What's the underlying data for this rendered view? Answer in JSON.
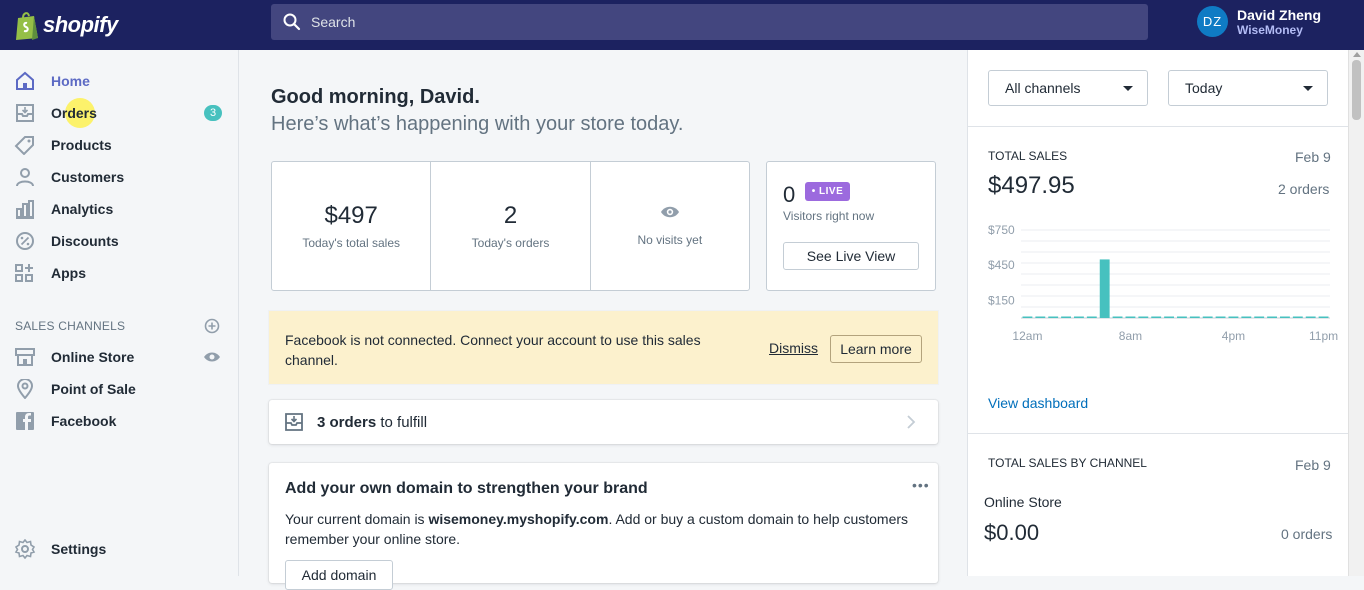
{
  "brand": {
    "logo_text": "shopify"
  },
  "search": {
    "placeholder": "Search"
  },
  "user": {
    "initials": "DZ",
    "name": "David Zheng",
    "store": "WiseMoney"
  },
  "sidebar": {
    "items": [
      {
        "label": "Home",
        "icon": "home-icon"
      },
      {
        "label": "Orders",
        "icon": "orders-icon",
        "badge": "3"
      },
      {
        "label": "Products",
        "icon": "tag-icon"
      },
      {
        "label": "Customers",
        "icon": "person-icon"
      },
      {
        "label": "Analytics",
        "icon": "bar-chart-icon"
      },
      {
        "label": "Discounts",
        "icon": "discount-icon"
      },
      {
        "label": "Apps",
        "icon": "apps-icon"
      }
    ],
    "channels_heading": "SALES CHANNELS",
    "channels": [
      {
        "label": "Online Store",
        "icon": "store-icon"
      },
      {
        "label": "Point of Sale",
        "icon": "location-pin-icon"
      },
      {
        "label": "Facebook",
        "icon": "facebook-icon"
      }
    ],
    "settings_label": "Settings"
  },
  "greeting": {
    "title": "Good morning, David.",
    "subtitle": "Here’s what’s happening with your store today."
  },
  "stats": [
    {
      "value": "$497",
      "label": "Today's total sales"
    },
    {
      "value": "2",
      "label": "Today's orders"
    },
    {
      "value": "",
      "label": "No visits yet"
    }
  ],
  "live": {
    "count": "0",
    "badge": "• LIVE",
    "subtitle": "Visitors right now",
    "button": "See Live View"
  },
  "banner": {
    "text": "Facebook is not connected. Connect your account to use this sales channel.",
    "dismiss": "Dismiss",
    "learn_more": "Learn more"
  },
  "fulfill": {
    "count_text": "3 orders",
    "suffix": " to fulfill"
  },
  "domain": {
    "title": "Add your own domain to strengthen your brand",
    "text_prefix": "Your current domain is ",
    "domain_name": "wisemoney.myshopify.com",
    "text_suffix": ". Add or buy a custom domain to help customers remember your online store.",
    "more": "•••",
    "button": "Add domain"
  },
  "filters": {
    "channel": "All channels",
    "period": "Today"
  },
  "total_sales": {
    "heading": "TOTAL SALES",
    "date": "Feb 9",
    "amount": "$497.95",
    "orders": "2 orders",
    "link": "View dashboard"
  },
  "chart_data": {
    "type": "bar",
    "y_tick_labels": [
      "$750",
      "$450",
      "$150"
    ],
    "x_tick_labels": [
      "12am",
      "8am",
      "4pm",
      "11pm"
    ],
    "hours": [
      "0",
      "1",
      "2",
      "3",
      "4",
      "5",
      "6",
      "7",
      "8",
      "9",
      "10",
      "11",
      "12",
      "13",
      "14",
      "15",
      "16",
      "17",
      "18",
      "19",
      "20",
      "21",
      "22",
      "23"
    ],
    "values": [
      0,
      0,
      0,
      0,
      0,
      0,
      497.95,
      0,
      0,
      0,
      0,
      0,
      0,
      0,
      0,
      0,
      0,
      0,
      0,
      0,
      0,
      0,
      0,
      0
    ],
    "ylim": [
      0,
      850
    ],
    "color": "#47c1bf"
  },
  "by_channel": {
    "heading": "TOTAL SALES BY CHANNEL",
    "date": "Feb 9",
    "channel": "Online Store",
    "amount": "$0.00",
    "orders": "0 orders"
  },
  "colors": {
    "topbar": "#1c2260",
    "accent": "#5c6ac4",
    "live": "#9c6ade",
    "teal": "#47c1bf",
    "link": "#006fbb"
  }
}
